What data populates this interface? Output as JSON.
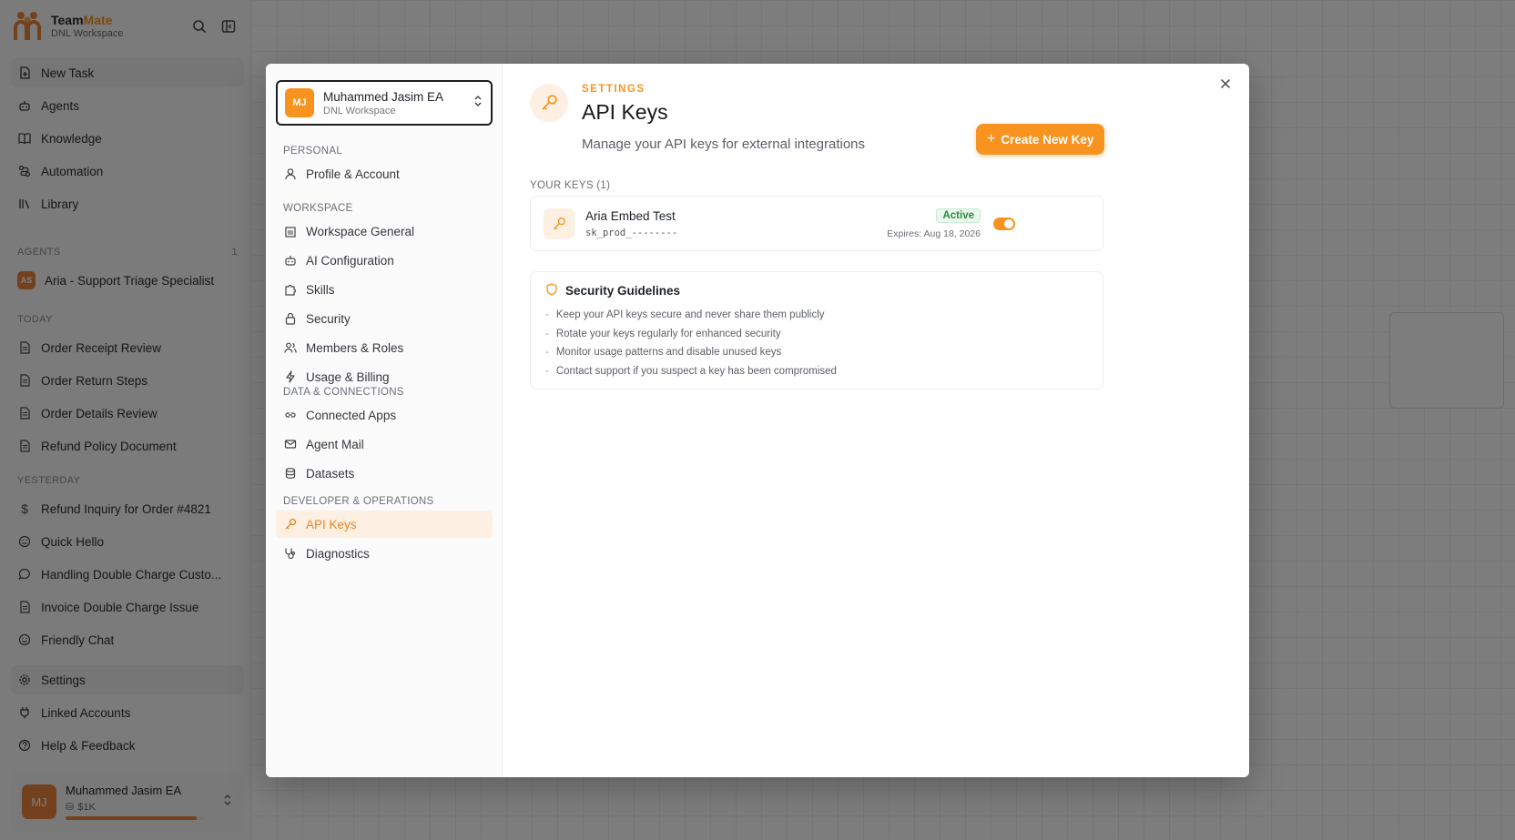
{
  "app": {
    "brand_name_1": "Team",
    "brand_name_2": "Mate",
    "workspace": "DNL Workspace"
  },
  "sidebar": {
    "main_items": [
      {
        "label": "New Task",
        "icon": "file-plus-icon"
      },
      {
        "label": "Agents",
        "icon": "robot-icon"
      },
      {
        "label": "Knowledge",
        "icon": "book-icon"
      },
      {
        "label": "Automation",
        "icon": "workflow-icon"
      },
      {
        "label": "Library",
        "icon": "library-icon"
      }
    ],
    "agents_label": "AGENTS",
    "agents_count": "1",
    "agent": {
      "initials": "AS",
      "name": "Aria - Support Triage Specialist"
    },
    "today_label": "TODAY",
    "today": [
      {
        "label": "Order Receipt Review",
        "icon": "document-icon"
      },
      {
        "label": "Order Return Steps",
        "icon": "document-icon"
      },
      {
        "label": "Order Details Review",
        "icon": "document-icon"
      },
      {
        "label": "Refund Policy Document",
        "icon": "document-icon"
      }
    ],
    "yesterday_label": "YESTERDAY",
    "yesterday": [
      {
        "label": "Refund Inquiry for Order #4821",
        "icon": "dollar-icon"
      },
      {
        "label": "Quick Hello",
        "icon": "smile-icon"
      },
      {
        "label": "Handling Double Charge Custo...",
        "icon": "chat-bubble-icon"
      },
      {
        "label": "Invoice Double Charge Issue",
        "icon": "document-icon"
      },
      {
        "label": "Friendly Chat",
        "icon": "smile-icon"
      }
    ],
    "bottom": [
      {
        "label": "Settings",
        "icon": "gear-icon"
      },
      {
        "label": "Linked Accounts",
        "icon": "plug-icon"
      },
      {
        "label": "Help & Feedback",
        "icon": "help-circle-icon"
      }
    ],
    "user": {
      "initials": "MJ",
      "name": "Muhammed Jasim EA",
      "credits": "$1K",
      "credit_fraction": 0.95
    }
  },
  "modal": {
    "workspace_switcher": {
      "initials": "MJ",
      "name": "Muhammed Jasim EA",
      "workspace": "DNL Workspace"
    },
    "sections": [
      {
        "label": "PERSONAL",
        "items": [
          {
            "label": "Profile & Account",
            "icon": "user-icon"
          }
        ]
      },
      {
        "label": "WORKSPACE",
        "items": [
          {
            "label": "Workspace General",
            "icon": "building-icon"
          },
          {
            "label": "AI Configuration",
            "icon": "robot-icon"
          },
          {
            "label": "Skills",
            "icon": "puzzle-icon"
          },
          {
            "label": "Security",
            "icon": "lock-icon"
          },
          {
            "label": "Members & Roles",
            "icon": "users-icon"
          },
          {
            "label": "Usage & Billing",
            "icon": "bolt-icon"
          }
        ]
      },
      {
        "label": "DATA & CONNECTIONS",
        "items": [
          {
            "label": "Connected Apps",
            "icon": "link-icon"
          },
          {
            "label": "Agent Mail",
            "icon": "mail-icon"
          },
          {
            "label": "Datasets",
            "icon": "database-icon"
          }
        ]
      },
      {
        "label": "DEVELOPER & OPERATIONS",
        "items": [
          {
            "label": "API Keys",
            "icon": "key-icon",
            "active": true
          },
          {
            "label": "Diagnostics",
            "icon": "stethoscope-icon"
          }
        ]
      }
    ],
    "header": {
      "eyebrow": "SETTINGS",
      "title": "API Keys",
      "subtitle": "Manage your API keys for external integrations",
      "create_label": "Create New Key"
    },
    "keys_label": "YOUR KEYS (1)",
    "keys": [
      {
        "name": "Aria Embed Test",
        "value": "sk_prod_--------",
        "status": "Active",
        "expires": "Expires: Aug 18, 2026",
        "enabled": true
      }
    ],
    "guidelines": {
      "title": "Security Guidelines",
      "items": [
        "Keep your API keys secure and never share them publicly",
        "Rotate your keys regularly for enhanced security",
        "Monitor usage patterns and disable unused keys",
        "Contact support if you suspect a key has been compromised"
      ]
    }
  },
  "colors": {
    "accent": "#f7931e",
    "agent_badge": "#e9823c",
    "active_green": "#2b8a3e"
  }
}
